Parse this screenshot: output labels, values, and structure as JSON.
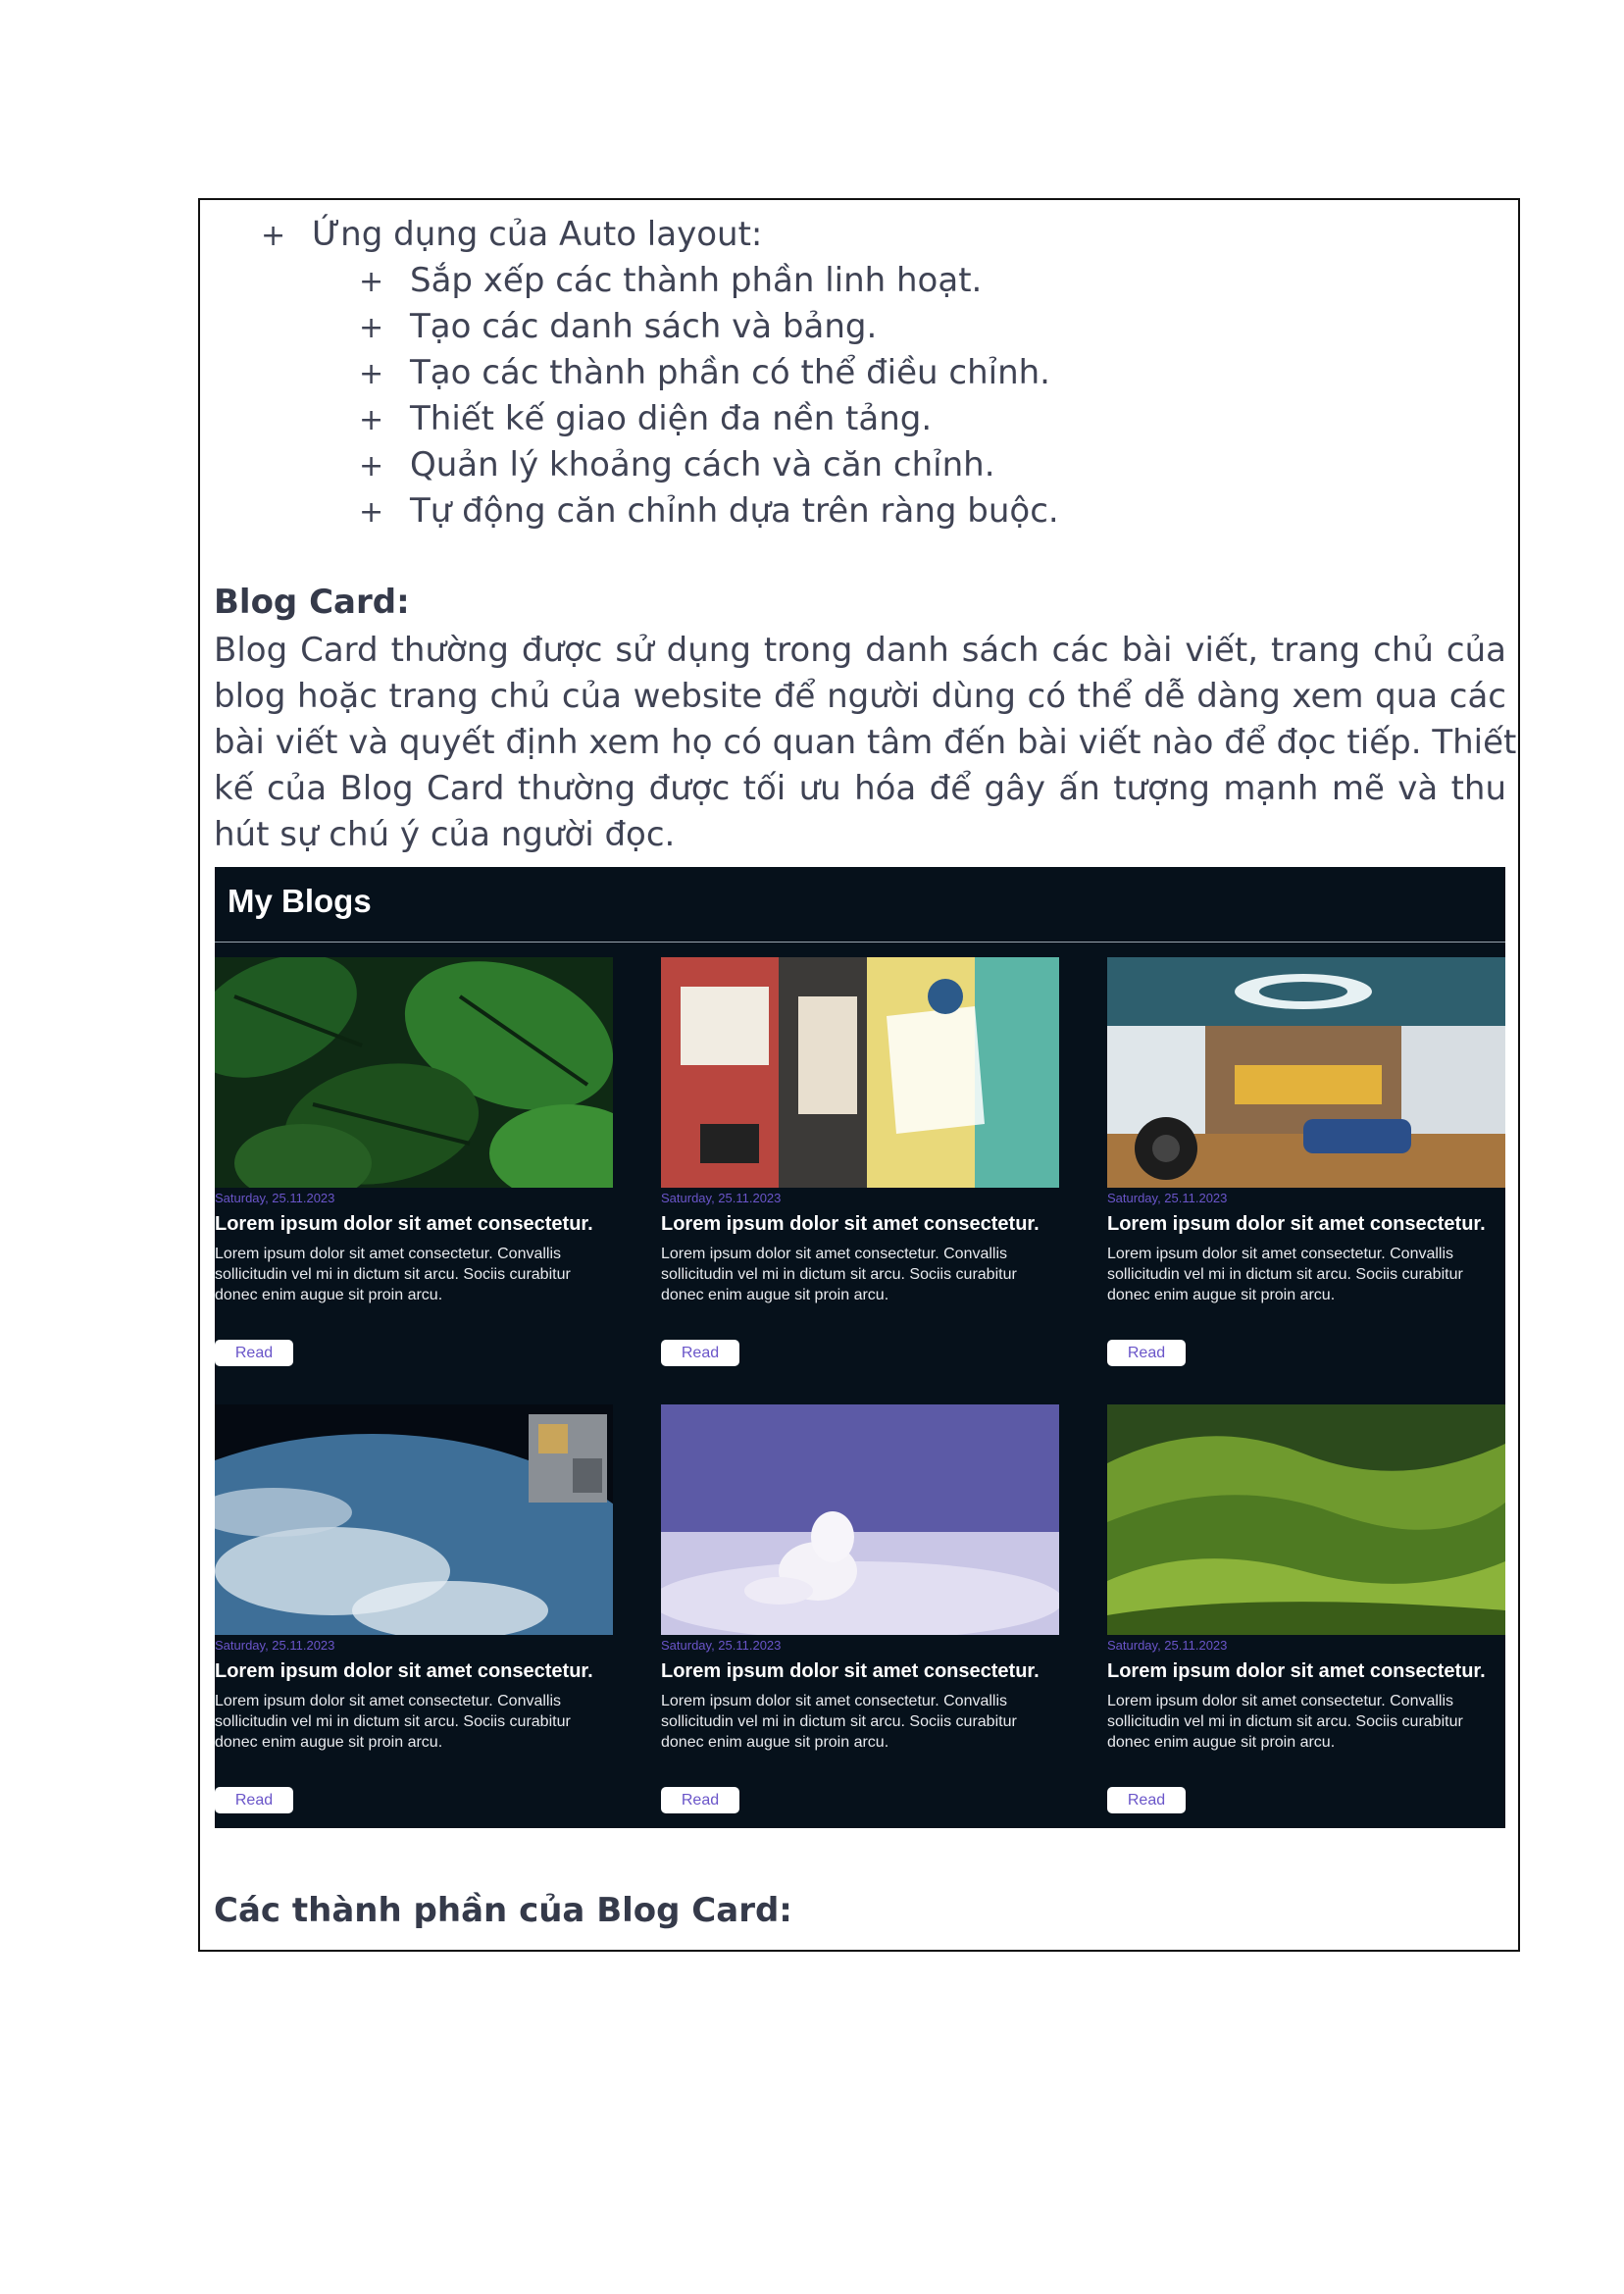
{
  "list": {
    "bullet": "+",
    "heading": "Ứng dụng của Auto layout:",
    "items": [
      "Sắp xếp các thành phần linh hoạt.",
      "Tạo các danh sách và bảng.",
      "Tạo các thành phần có thể điều chỉnh.",
      "Thiết kế giao diện đa nền tảng.",
      "Quản lý khoảng cách và căn chỉnh.",
      "Tự động căn chỉnh dựa trên ràng buộc."
    ]
  },
  "blog_card_section": {
    "heading": "Blog Card:",
    "paragraph_lines": [
      "Blog Card thường được sử dụng trong danh sách các bài viết, trang chủ của",
      "blog hoặc trang chủ của website để người dùng có thể dễ dàng xem qua các",
      "bài viết và quyết định xem họ có quan tâm đến bài viết nào để đọc tiếp. Thiết",
      "kế của Blog Card thường được tối ưu hóa để gây ấn tượng mạnh mẽ và thu",
      "hút sự chú ý của người đọc."
    ]
  },
  "blogs": {
    "title": "My Blogs",
    "cards": [
      {
        "image": "monstera-leaves-photo",
        "date": "Saturday, 25.11.2023",
        "title": "Lorem ipsum dolor sit amet consectetur.",
        "desc_lines": [
          "Lorem ipsum dolor sit amet consectetur. Convallis",
          "sollicitudin vel mi in dictum sit arcu. Sociis curabitur",
          "donec enim augue sit proin arcu."
        ],
        "button": "Read"
      },
      {
        "image": "torn-posters-photo",
        "date": "Saturday, 25.11.2023",
        "title": "Lorem ipsum dolor sit amet consectetur.",
        "desc_lines": [
          "Lorem ipsum dolor sit amet consectetur. Convallis",
          "sollicitudin vel mi in dictum sit arcu. Sociis curabitur",
          "donec enim augue sit proin arcu."
        ],
        "button": "Read"
      },
      {
        "image": "steam-classroom-photo",
        "date": "Saturday, 25.11.2023",
        "title": "Lorem ipsum dolor sit amet consectetur.",
        "desc_lines": [
          "Lorem ipsum dolor sit amet consectetur. Convallis",
          "sollicitudin vel mi in dictum sit arcu. Sociis curabitur",
          "donec enim augue sit proin arcu."
        ],
        "button": "Read"
      },
      {
        "image": "earth-from-space-photo",
        "date": "Saturday, 25.11.2023",
        "title": "Lorem ipsum dolor sit amet consectetur.",
        "desc_lines": [
          "Lorem ipsum dolor sit amet consectetur. Convallis",
          "sollicitudin vel mi in dictum sit arcu. Sociis curabitur",
          "donec enim augue sit proin arcu."
        ],
        "button": "Read"
      },
      {
        "image": "arctic-fox-photo",
        "date": "Saturday, 25.11.2023",
        "title": "Lorem ipsum dolor sit amet consectetur.",
        "desc_lines": [
          "Lorem ipsum dolor sit amet consectetur. Convallis",
          "sollicitudin vel mi in dictum sit arcu. Sociis curabitur",
          "donec enim augue sit proin arcu."
        ],
        "button": "Read"
      },
      {
        "image": "green-hills-photo",
        "date": "Saturday, 25.11.2023",
        "title": "Lorem ipsum dolor sit amet consectetur.",
        "desc_lines": [
          "Lorem ipsum dolor sit amet consectetur. Convallis",
          "sollicitudin vel mi in dictum sit arcu. Sociis curabitur",
          "donec enim augue sit proin arcu."
        ],
        "button": "Read"
      }
    ]
  },
  "components_heading": "Các thành phần của Blog Card:"
}
